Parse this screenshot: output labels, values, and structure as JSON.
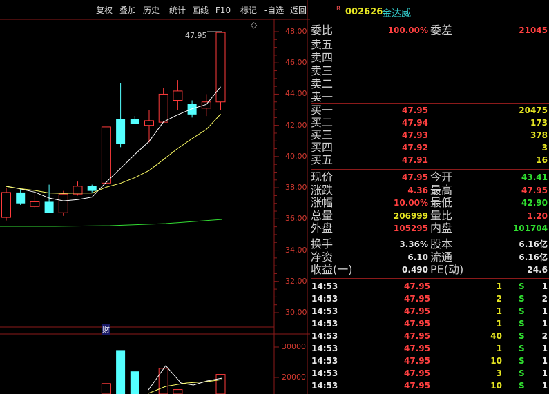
{
  "toolbar": [
    "复权",
    "叠加",
    "历史",
    "统计",
    "画线",
    "F10",
    "标记",
    "-自选",
    "返回"
  ],
  "stock": {
    "badge": "R",
    "code": "002626",
    "name": "金达威"
  },
  "chart": {
    "last_price_label": "47.95",
    "price_ticks": [
      "48.00",
      "46.00",
      "44.00",
      "42.00",
      "40.00",
      "38.00",
      "36.00",
      "34.00",
      "32.00",
      "30.00"
    ],
    "volume_ticks": [
      "30000",
      "20000"
    ],
    "fin_badge": "财",
    "diamond": "◇",
    "candles": [
      {
        "o": 36.1,
        "c": 37.7,
        "h": 38.0,
        "l": 35.9,
        "up": true
      },
      {
        "o": 37.7,
        "c": 37.0,
        "h": 37.9,
        "l": 36.9,
        "up": false
      },
      {
        "o": 36.8,
        "c": 37.1,
        "h": 37.6,
        "l": 36.7,
        "up": true
      },
      {
        "o": 37.1,
        "c": 36.4,
        "h": 38.2,
        "l": 36.4,
        "up": false
      },
      {
        "o": 36.4,
        "c": 37.6,
        "h": 37.8,
        "l": 36.2,
        "up": true
      },
      {
        "o": 37.6,
        "c": 38.1,
        "h": 38.4,
        "l": 37.5,
        "up": true
      },
      {
        "o": 38.1,
        "c": 37.8,
        "h": 38.2,
        "l": 37.7,
        "up": false
      },
      {
        "o": 38.3,
        "c": 41.9,
        "h": 41.9,
        "l": 38.3,
        "up": true
      },
      {
        "o": 42.4,
        "c": 40.8,
        "h": 44.7,
        "l": 40.6,
        "up": false
      },
      {
        "o": 42.4,
        "c": 42.1,
        "h": 42.6,
        "l": 42.1,
        "up": false
      },
      {
        "o": 42.0,
        "c": 42.3,
        "h": 43.0,
        "l": 40.9,
        "up": true
      },
      {
        "o": 42.2,
        "c": 44.0,
        "h": 44.4,
        "l": 42.2,
        "up": true
      },
      {
        "o": 43.6,
        "c": 44.2,
        "h": 44.9,
        "l": 43.0,
        "up": true
      },
      {
        "o": 43.4,
        "c": 42.7,
        "h": 43.6,
        "l": 42.5,
        "up": false
      },
      {
        "o": 43.1,
        "c": 43.5,
        "h": 44.0,
        "l": 42.6,
        "up": true
      },
      {
        "o": 43.5,
        "c": 47.95,
        "h": 48.0,
        "l": 43.0,
        "up": true
      }
    ],
    "volumes": [
      0,
      0,
      0,
      0,
      0,
      0,
      0,
      18000,
      29000,
      22000,
      14000,
      23000,
      16000,
      8000,
      12000,
      21000
    ],
    "volume_up": [
      true,
      false,
      true,
      false,
      true,
      true,
      false,
      true,
      false,
      false,
      true,
      true,
      true,
      false,
      true,
      true
    ]
  },
  "quote": {
    "weibi_label": "委比",
    "weibi": "100.00%",
    "weicha_label": "委差",
    "weicha": "21045",
    "sell": [
      {
        "label": "卖五"
      },
      {
        "label": "卖四"
      },
      {
        "label": "卖三"
      },
      {
        "label": "卖二"
      },
      {
        "label": "卖一"
      }
    ],
    "buy": [
      {
        "label": "买一",
        "price": "47.95",
        "vol": "20475"
      },
      {
        "label": "买二",
        "price": "47.94",
        "vol": "173"
      },
      {
        "label": "买三",
        "price": "47.93",
        "vol": "378"
      },
      {
        "label": "买四",
        "price": "47.92",
        "vol": "3"
      },
      {
        "label": "买五",
        "price": "47.91",
        "vol": "16"
      }
    ],
    "stats": [
      {
        "l1": "现价",
        "v1": "47.95",
        "c1": "red",
        "l2": "今开",
        "v2": "43.41",
        "c2": "grn"
      },
      {
        "l1": "涨跌",
        "v1": "4.36",
        "c1": "red",
        "l2": "最高",
        "v2": "47.95",
        "c2": "red"
      },
      {
        "l1": "涨幅",
        "v1": "10.00%",
        "c1": "red",
        "l2": "最低",
        "v2": "42.90",
        "c2": "grn"
      },
      {
        "l1": "总量",
        "v1": "206999",
        "c1": "yel",
        "l2": "量比",
        "v2": "1.20",
        "c2": "red"
      },
      {
        "l1": "外盘",
        "v1": "105295",
        "c1": "red",
        "l2": "内盘",
        "v2": "101704",
        "c2": "grn"
      }
    ],
    "fund": [
      {
        "l1": "换手",
        "v1": "3.36%",
        "l2": "股本",
        "v2": "6.16亿"
      },
      {
        "l1": "净资",
        "v1": "6.10",
        "l2": "流通",
        "v2": "6.16亿"
      },
      {
        "l1": "收益(一)",
        "v1": "0.490",
        "l2": "PE(动)",
        "v2": "24.6"
      }
    ]
  },
  "ticks": [
    {
      "t": "14:53",
      "p": "47.95",
      "v": "1",
      "s": "S",
      "n": "1"
    },
    {
      "t": "14:53",
      "p": "47.95",
      "v": "2",
      "s": "S",
      "n": "2"
    },
    {
      "t": "14:53",
      "p": "47.95",
      "v": "1",
      "s": "S",
      "n": "1"
    },
    {
      "t": "14:53",
      "p": "47.95",
      "v": "1",
      "s": "S",
      "n": "1"
    },
    {
      "t": "14:53",
      "p": "47.95",
      "v": "40",
      "s": "S",
      "n": "2"
    },
    {
      "t": "14:53",
      "p": "47.95",
      "v": "1",
      "s": "S",
      "n": "1"
    },
    {
      "t": "14:53",
      "p": "47.95",
      "v": "10",
      "s": "S",
      "n": "1"
    },
    {
      "t": "14:53",
      "p": "47.95",
      "v": "3",
      "s": "S",
      "n": "1"
    },
    {
      "t": "14:53",
      "p": "47.95",
      "v": "10",
      "s": "S",
      "n": "1"
    }
  ],
  "colors": {
    "up": "#ff3b3b",
    "down": "#54ffff",
    "ma1": "#ffffff",
    "ma2": "#ffff66",
    "ma3": "#33dd33",
    "grid": "#8b1a1a"
  }
}
